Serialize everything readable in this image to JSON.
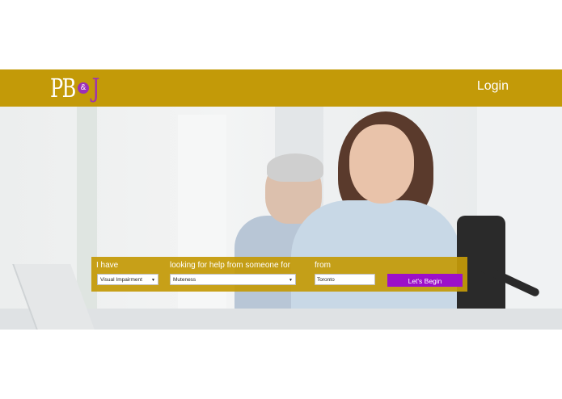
{
  "header": {
    "logo": {
      "pb": "PB",
      "amp": "&",
      "j": "J"
    },
    "login_label": "Login"
  },
  "search": {
    "label_have": "I have",
    "label_looking": "looking for help from someone for",
    "label_from": "from",
    "have_value": "Visual Impairment",
    "looking_value": "Muteness",
    "from_value": "Toronto",
    "submit_label": "Let's Begin",
    "dropdown_arrow": "▼"
  },
  "colors": {
    "brand_gold": "#c39a08",
    "accent_purple": "#9c10c9"
  }
}
